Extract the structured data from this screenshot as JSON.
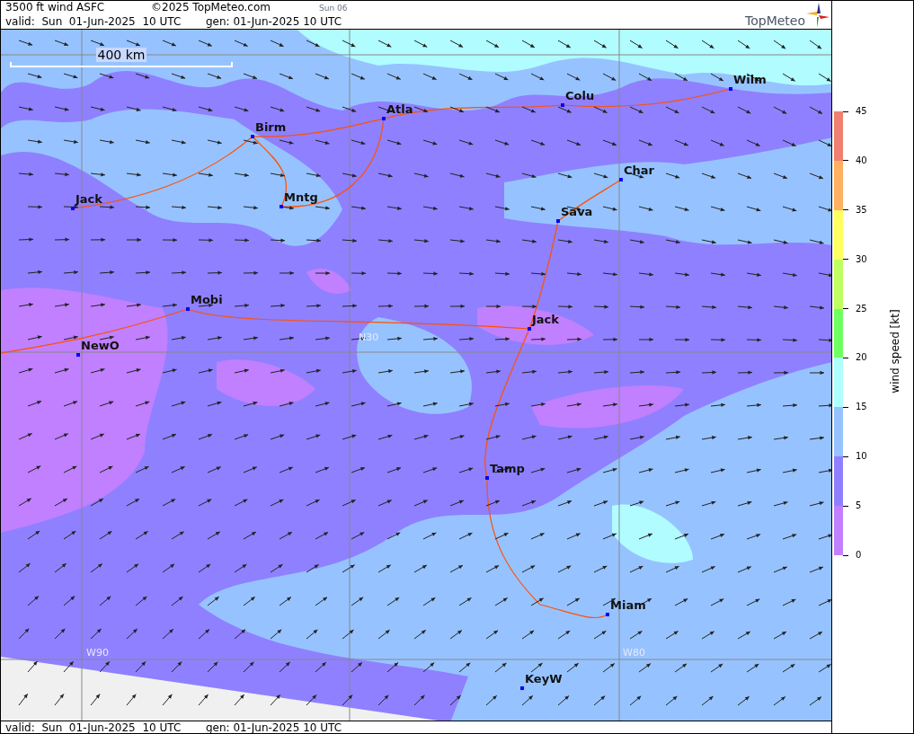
{
  "header": {
    "title": "3500 ft wind ASFC",
    "copyright": "©2025 TopMeteo.com",
    "day_code": "Sun 06",
    "valid": "valid:  Sun  01-Jun-2025  10 UTC",
    "generated": "gen: 01-Jun-2025 10 UTC",
    "logo": "TopMeteo"
  },
  "map": {
    "scale_label": "400 km",
    "cities": [
      {
        "name": "Wilm"
      },
      {
        "name": "Colu"
      },
      {
        "name": "Atla"
      },
      {
        "name": "Birm"
      },
      {
        "name": "Char"
      },
      {
        "name": "Jack"
      },
      {
        "name": "Mntg"
      },
      {
        "name": "Sava"
      },
      {
        "name": "Mobi"
      },
      {
        "name": "Jack"
      },
      {
        "name": "NewO"
      },
      {
        "name": "Tamp"
      },
      {
        "name": "Miam"
      },
      {
        "name": "KeyW"
      }
    ],
    "grid_labels": [
      "N30",
      "W90",
      "W80"
    ]
  },
  "legend": {
    "title": "wind speed [kt]",
    "segments": [
      {
        "color": "#f08070"
      },
      {
        "color": "#ffb060"
      },
      {
        "color": "#ffff60"
      },
      {
        "color": "#c0ff60"
      },
      {
        "color": "#70ff60"
      },
      {
        "color": "#b0ffff"
      },
      {
        "color": "#96c3ff"
      },
      {
        "color": "#8f80ff"
      },
      {
        "color": "#c080ff"
      }
    ],
    "ticks": [
      "45",
      "40",
      "35",
      "30",
      "25",
      "20",
      "15",
      "10",
      "5",
      "0"
    ]
  },
  "footer": {
    "valid": "valid:  Sun  01-Jun-2025  10 UTC",
    "generated": "gen: 01-Jun-2025 10 UTC"
  }
}
